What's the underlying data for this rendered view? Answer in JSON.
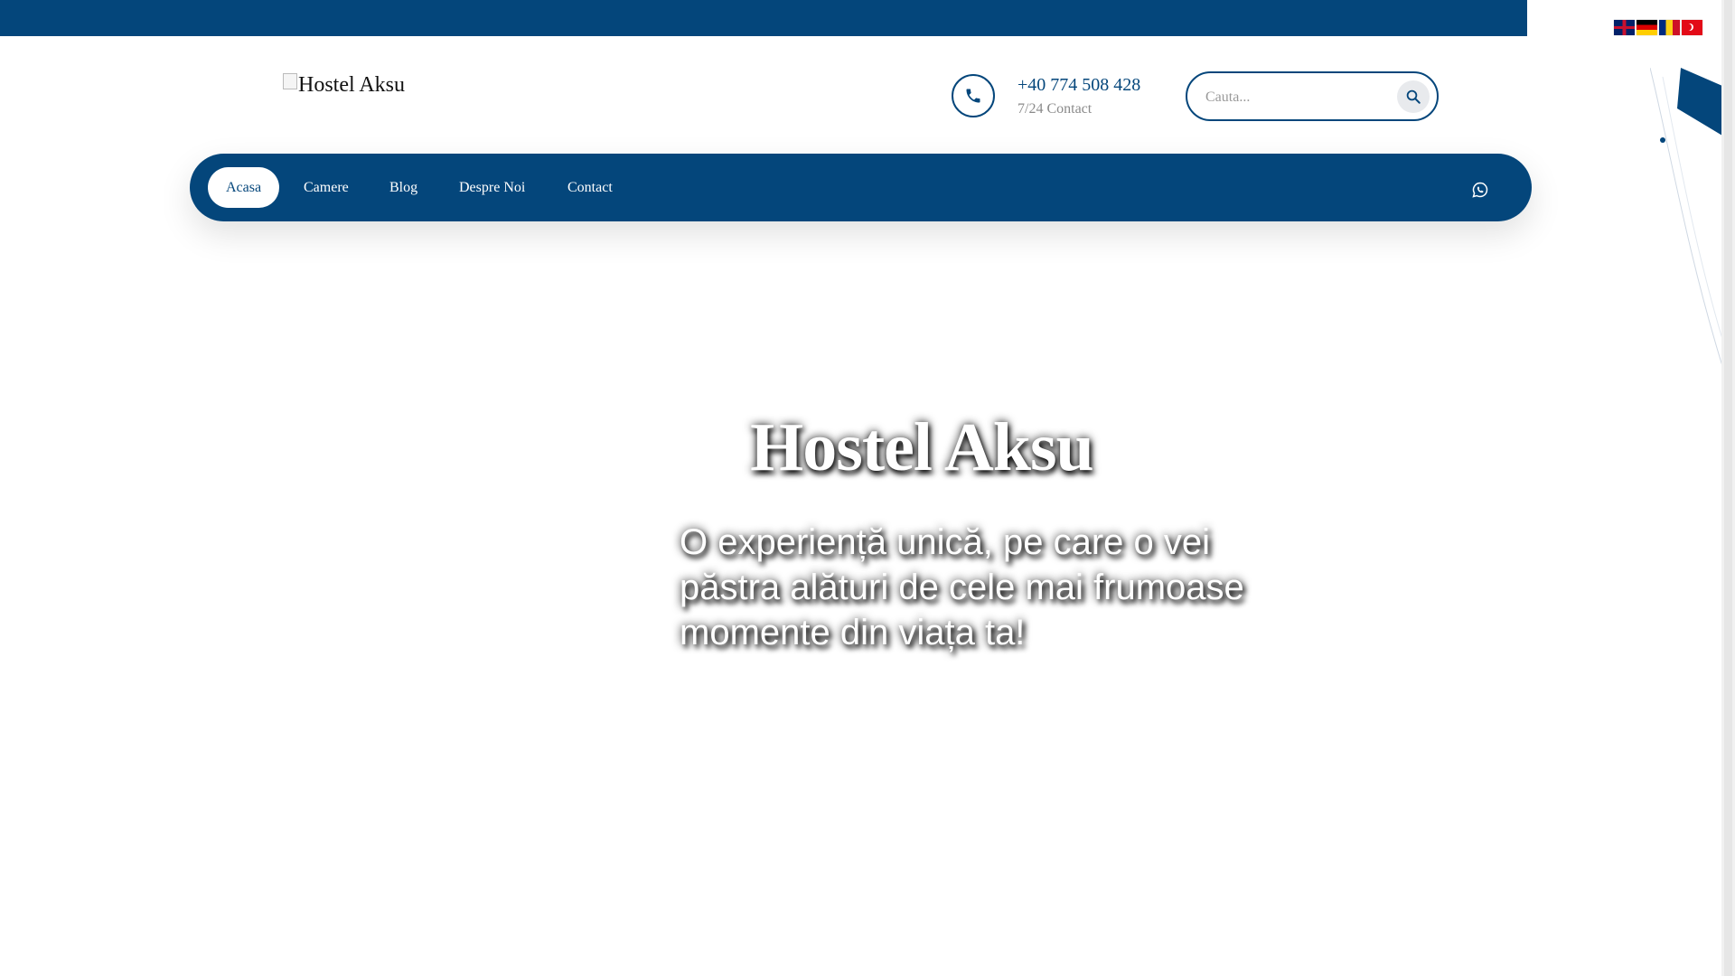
{
  "header": {
    "logo_alt": "Hostel Aksu",
    "phone": "+40 774 508 428",
    "phone_sub": "7/24 Contact",
    "search_placeholder": "Cauta..."
  },
  "languages": [
    "English",
    "Deutsch",
    "Română",
    "Türkçe"
  ],
  "nav": {
    "items": [
      {
        "label": "Acasa",
        "active": true
      },
      {
        "label": "Camere"
      },
      {
        "label": "Blog"
      },
      {
        "label": "Despre Noi"
      },
      {
        "label": "Contact"
      }
    ]
  },
  "hero": {
    "title": "Hostel Aksu",
    "subtitle": "O experiență unică, pe care o vei păstra alături de cele mai frumoase momente din viața ta!"
  },
  "colors": {
    "brand": "#04467b",
    "white": "#ffffff"
  },
  "icons": {
    "phone": "phone-icon",
    "search": "search-icon",
    "whatsapp": "whatsapp-icon"
  }
}
